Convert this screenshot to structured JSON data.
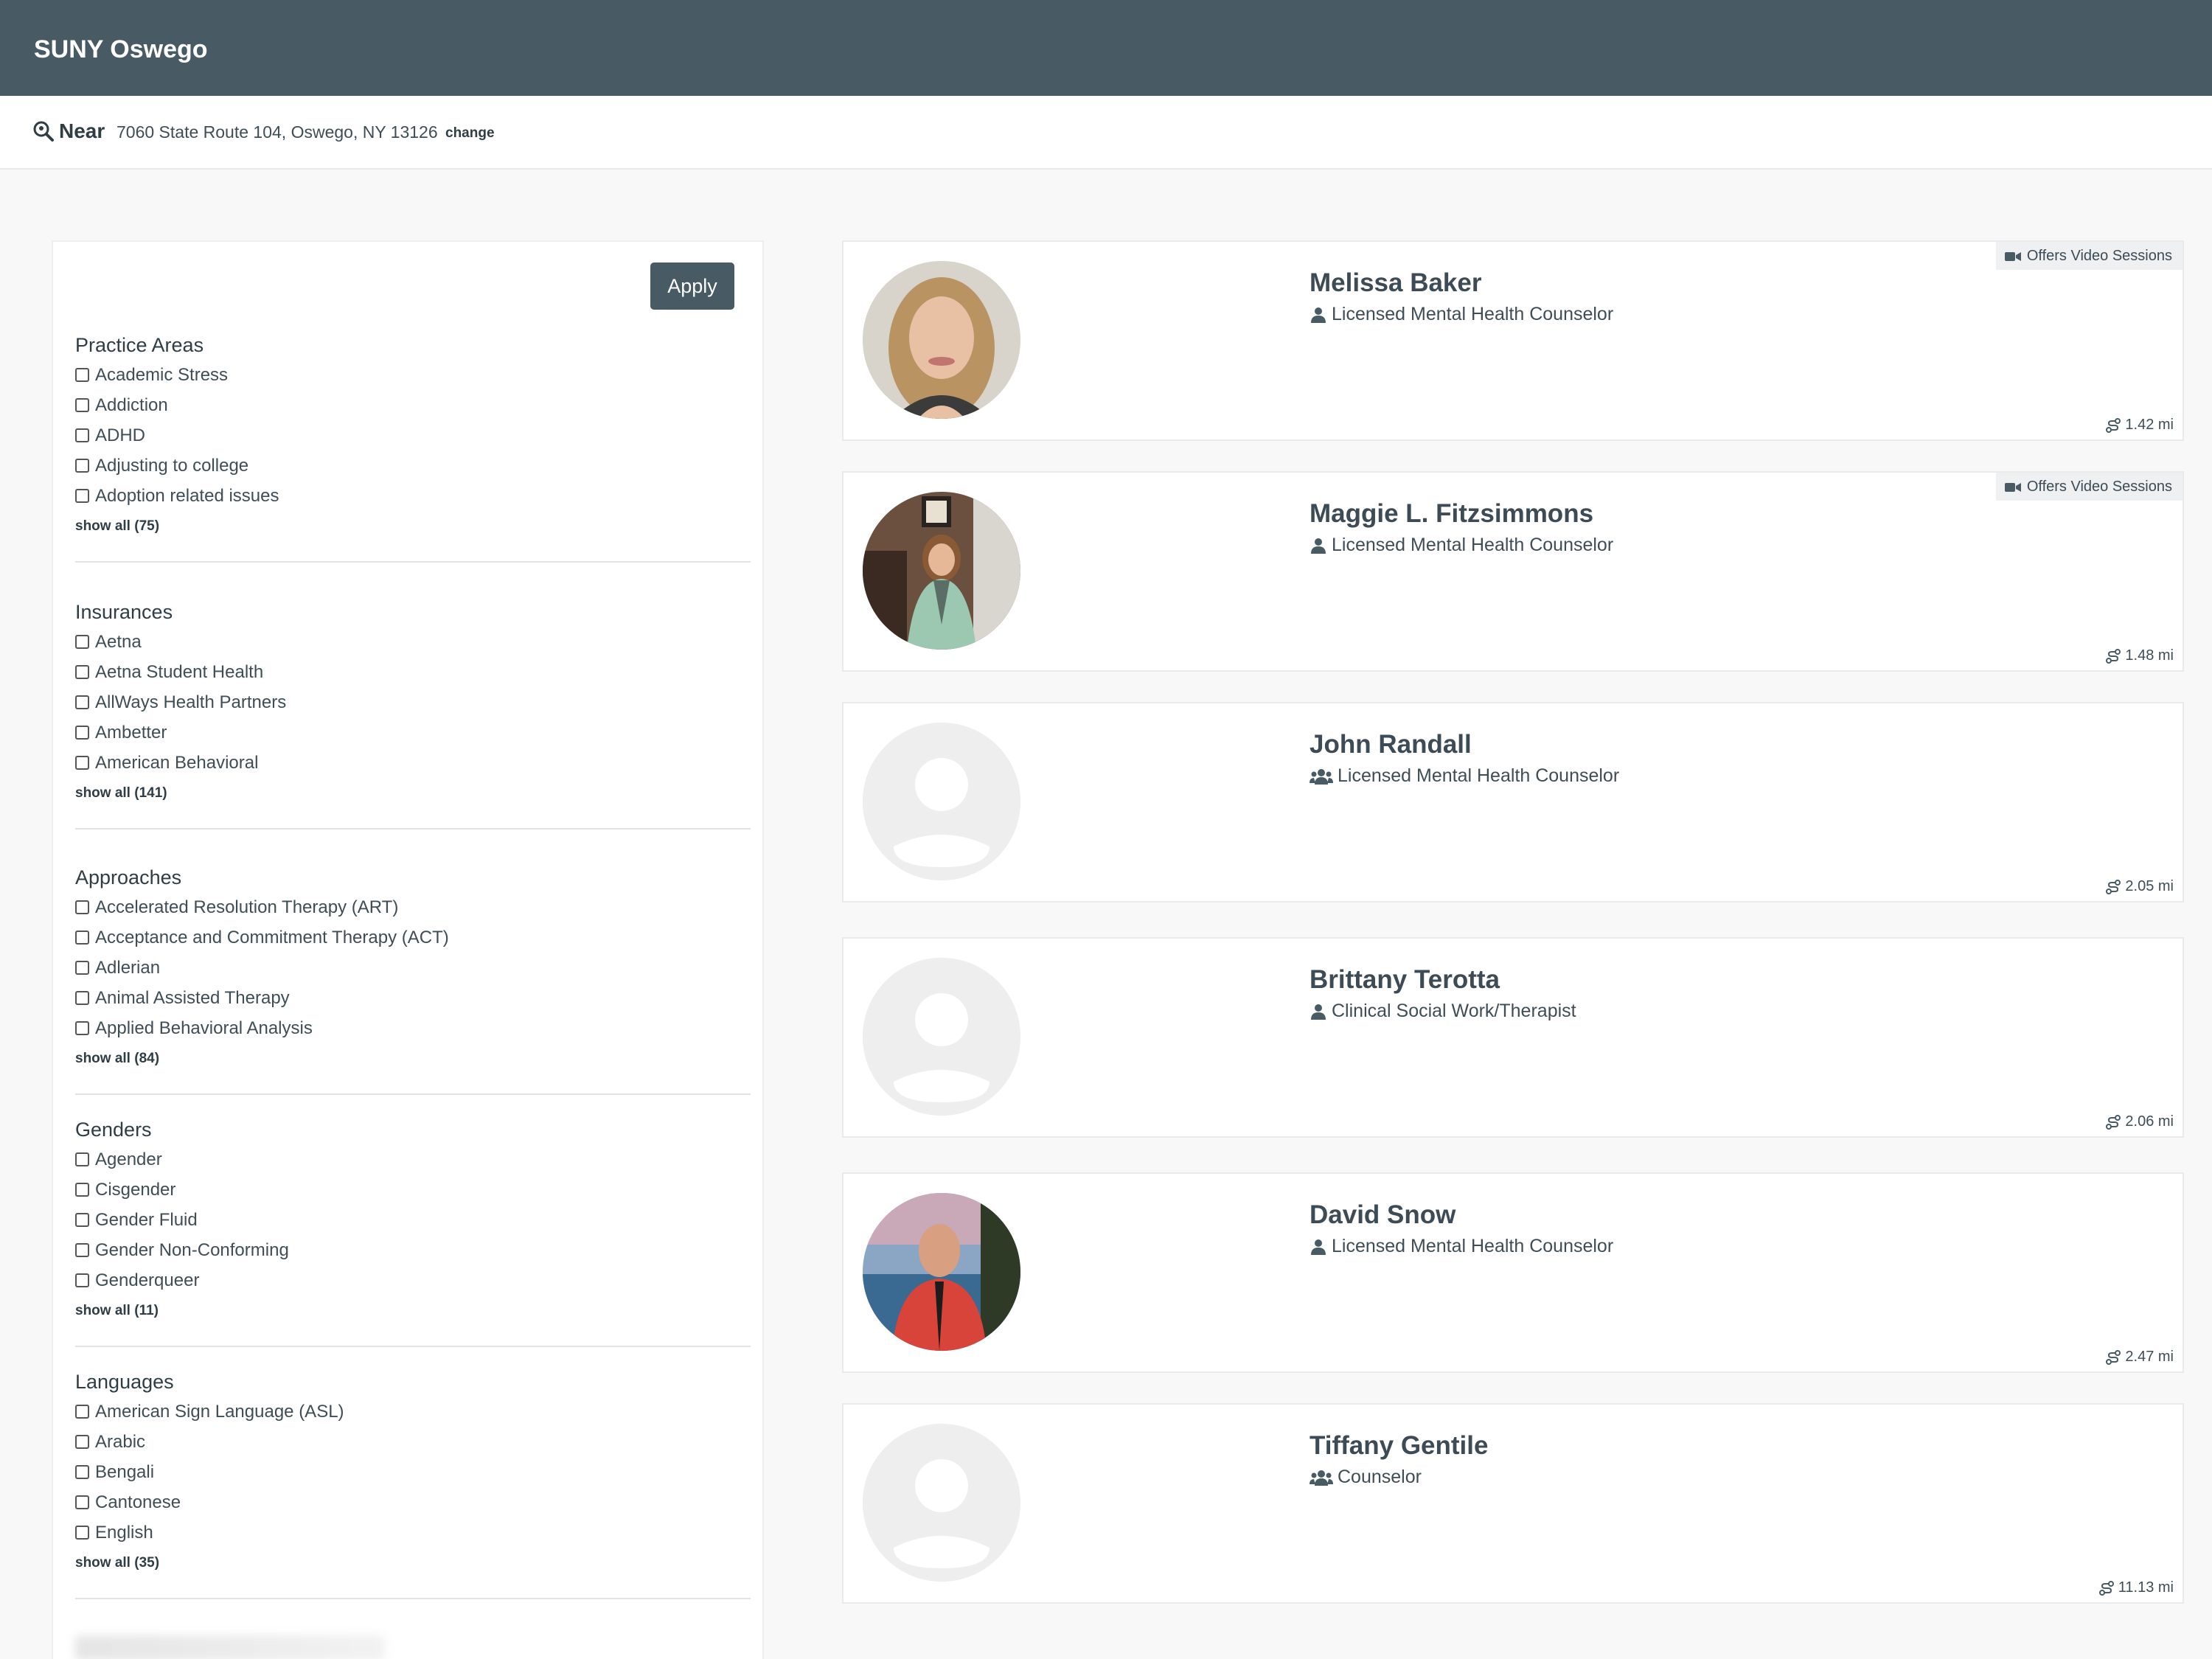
{
  "header": {
    "title": "SUNY Oswego"
  },
  "location": {
    "label": "Near",
    "address": "7060 State Route 104, Oswego, NY 13126",
    "change_label": "change"
  },
  "filters": {
    "apply_label": "Apply",
    "groups": [
      {
        "title": "Practice Areas",
        "options": [
          "Academic Stress",
          "Addiction",
          "ADHD",
          "Adjusting to college",
          "Adoption related issues"
        ],
        "show_all": "show all (75)"
      },
      {
        "title": "Insurances",
        "options": [
          "Aetna",
          "Aetna Student Health",
          "AllWays Health Partners",
          "Ambetter",
          "American Behavioral"
        ],
        "show_all": "show all (141)"
      },
      {
        "title": "Approaches",
        "options": [
          "Accelerated Resolution Therapy (ART)",
          "Acceptance and Commitment Therapy (ACT)",
          "Adlerian",
          "Animal Assisted Therapy",
          "Applied Behavioral Analysis"
        ],
        "show_all": "show all (84)"
      },
      {
        "title": "Genders",
        "options": [
          "Agender",
          "Cisgender",
          "Gender Fluid",
          "Gender Non-Conforming",
          "Genderqueer"
        ],
        "show_all": "show all (11)"
      },
      {
        "title": "Languages",
        "options": [
          "American Sign Language (ASL)",
          "Arabic",
          "Bengali",
          "Cantonese",
          "English"
        ],
        "show_all": "show all (35)"
      }
    ]
  },
  "providers": [
    {
      "name": "Melissa Baker",
      "role": "Licensed Mental Health Counselor",
      "role_icon": "user-icon",
      "video_badge": "Offers Video Sessions",
      "distance": "1.42 mi",
      "photo": "photo"
    },
    {
      "name": "Maggie L. Fitzsimmons",
      "role": "Licensed Mental Health Counselor",
      "role_icon": "user-icon",
      "video_badge": "Offers Video Sessions",
      "distance": "1.48 mi",
      "photo": "photo"
    },
    {
      "name": "John Randall",
      "role": "Licensed Mental Health Counselor",
      "role_icon": "users-icon",
      "video_badge": "",
      "distance": "2.05 mi",
      "photo": "placeholder"
    },
    {
      "name": "Brittany Terotta",
      "role": "Clinical Social Work/Therapist",
      "role_icon": "user-icon",
      "video_badge": "",
      "distance": "2.06 mi",
      "photo": "placeholder"
    },
    {
      "name": "David Snow",
      "role": "Licensed Mental Health Counselor",
      "role_icon": "user-icon",
      "video_badge": "",
      "distance": "2.47 mi",
      "photo": "photo"
    },
    {
      "name": "Tiffany Gentile",
      "role": "Counselor",
      "role_icon": "users-icon",
      "video_badge": "",
      "distance": "11.13 mi",
      "photo": "placeholder"
    }
  ],
  "colors": {
    "header_bg": "#485a63",
    "apply_bg": "#485a63",
    "badge_bg": "#eef0f1",
    "page_bg": "#f8f8f8"
  }
}
